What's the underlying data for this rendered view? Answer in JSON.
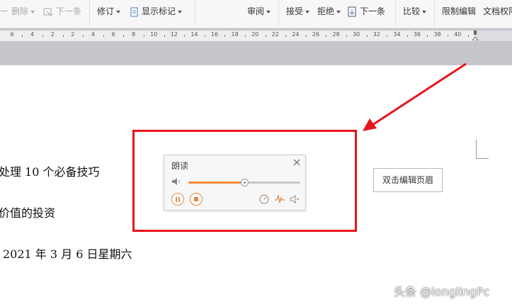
{
  "toolbar": {
    "delete_label": "删除",
    "next1_label": "下一条",
    "revise_label": "修订",
    "show_marks_label": "显示标记",
    "review_label": "审阅",
    "accept_label": "接受",
    "reject_label": "拒绝",
    "next2_label": "下一条",
    "compare_label": "比较",
    "restrict_label": "限制编辑",
    "doc_rights_label": "文档权限"
  },
  "ruler": {
    "labels": [
      "6",
      "4",
      "2",
      "2",
      "4",
      "6",
      "8",
      "10",
      "12",
      "14",
      "16",
      "18",
      "20",
      "22",
      "24",
      "26",
      "28",
      "30",
      "32",
      "34",
      "36",
      "38",
      "40"
    ]
  },
  "document": {
    "line1": "处理 10 个必备技巧",
    "line2": "价值的投资",
    "line3": "2021 年 3 月 6 日星期六"
  },
  "header_button_label": "双击编辑页眉",
  "read_panel": {
    "title": "朗读",
    "volume_level": 0.5
  },
  "watermark": "头条 @longlingPc",
  "colors": {
    "accent_orange": "#f08a3c",
    "annotation_red": "#e8141b"
  }
}
